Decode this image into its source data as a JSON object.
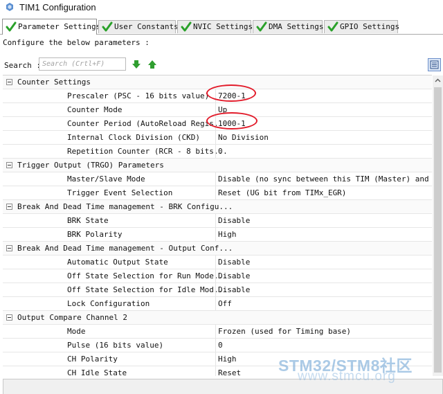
{
  "window": {
    "title": "TIM1 Configuration"
  },
  "tabs": [
    {
      "label": "Parameter Settings",
      "active": true
    },
    {
      "label": "User Constants",
      "active": false
    },
    {
      "label": "NVIC Settings",
      "active": false
    },
    {
      "label": "DMA Settings",
      "active": false
    },
    {
      "label": "GPIO Settings",
      "active": false
    }
  ],
  "configure_text": "Configure the below parameters :",
  "search": {
    "label": "Search :",
    "placeholder": "Search (Crtl+F)"
  },
  "groups": [
    {
      "title": "Counter Settings",
      "params": [
        {
          "name": "Prescaler (PSC - 16 bits value)",
          "value": "7200-1"
        },
        {
          "name": "Counter Mode",
          "value": "Up"
        },
        {
          "name": "Counter Period (AutoReload Regis...",
          "value": "1000-1"
        },
        {
          "name": "Internal Clock Division (CKD)",
          "value": "No Division"
        },
        {
          "name": "Repetition Counter (RCR - 8 bits...",
          "value": "0"
        }
      ]
    },
    {
      "title": "Trigger Output (TRGO) Parameters",
      "params": [
        {
          "name": "Master/Slave Mode",
          "value": "Disable (no sync between this TIM (Master) and ..."
        },
        {
          "name": "Trigger Event Selection",
          "value": "Reset (UG bit from TIMx_EGR)"
        }
      ]
    },
    {
      "title": "Break And Dead Time management - BRK Configu...",
      "params": [
        {
          "name": "BRK State",
          "value": "Disable"
        },
        {
          "name": "BRK Polarity",
          "value": "High"
        }
      ]
    },
    {
      "title": "Break And Dead Time management - Output Conf...",
      "params": [
        {
          "name": "Automatic Output State",
          "value": "Disable"
        },
        {
          "name": "Off State Selection for Run Mode...",
          "value": "Disable"
        },
        {
          "name": "Off State Selection for Idle Mod...",
          "value": "Disable"
        },
        {
          "name": "Lock Configuration",
          "value": "Off"
        }
      ]
    },
    {
      "title": "Output Compare Channel 2",
      "params": [
        {
          "name": "Mode",
          "value": "Frozen (used for Timing base)"
        },
        {
          "name": "Pulse (16 bits value)",
          "value": "0"
        },
        {
          "name": "CH Polarity",
          "value": "High"
        },
        {
          "name": "CH Idle State",
          "value": "Reset"
        }
      ]
    }
  ],
  "watermark": {
    "line1": "STM32/STM8社区",
    "line2": "www.stmcu.org"
  },
  "colors": {
    "highlight_ellipse": "#e21b2a",
    "check_green": "#2aa12a",
    "arrow_green": "#2f9e2f"
  },
  "icons": {
    "check": "check-icon",
    "title": "chip-icon",
    "down": "arrow-down-icon",
    "up": "arrow-up-icon",
    "view": "list-view-icon"
  }
}
